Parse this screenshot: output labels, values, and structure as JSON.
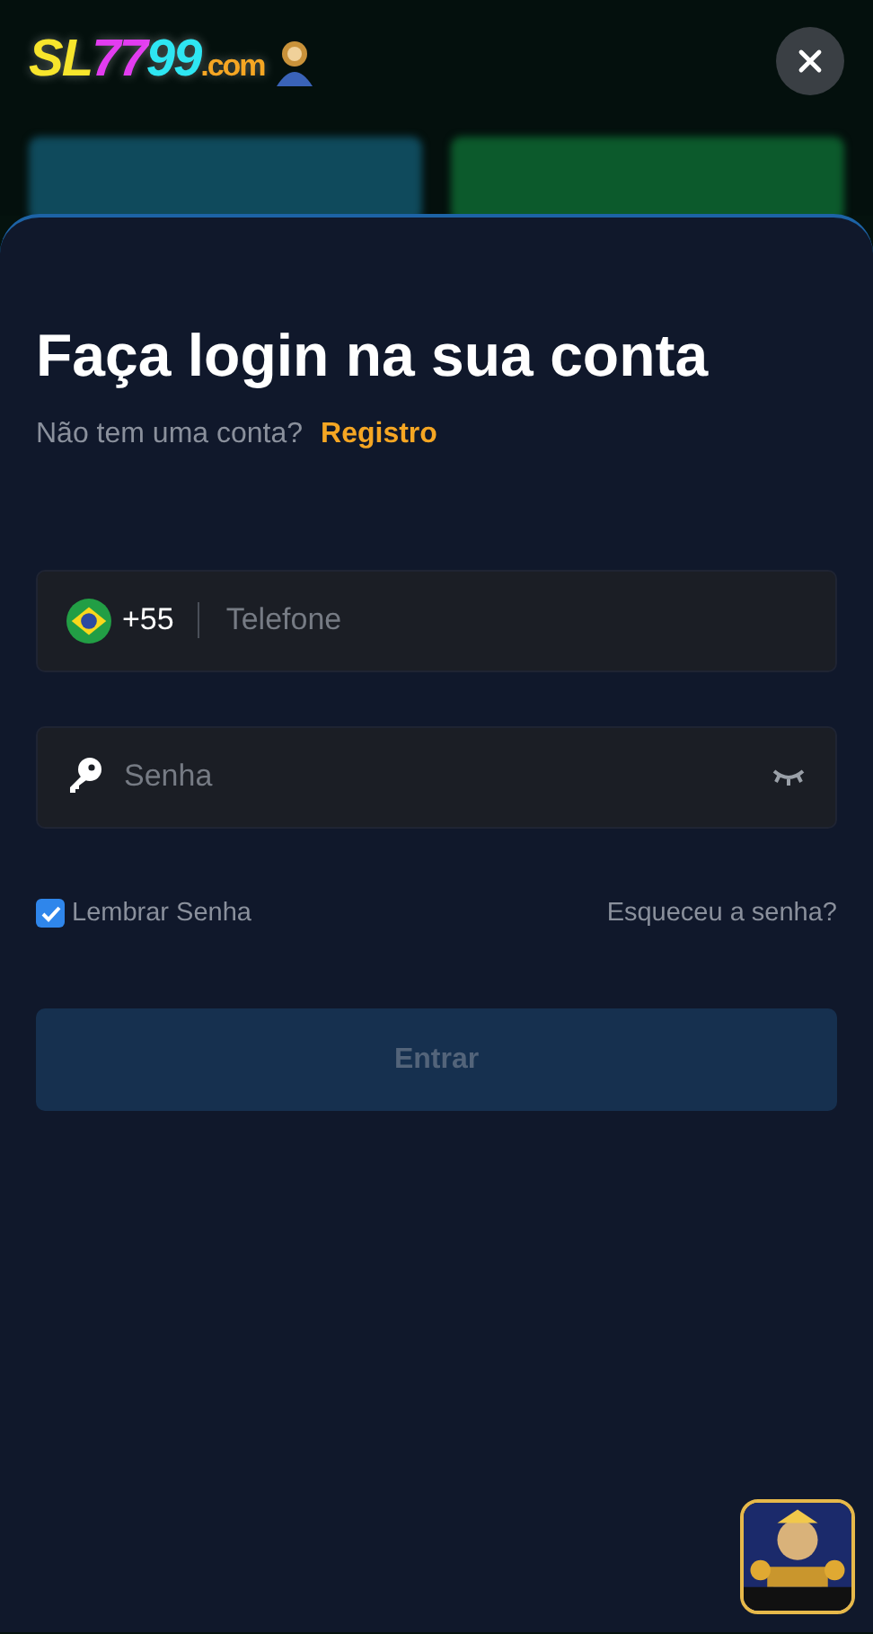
{
  "logo": [
    {
      "text": "SL",
      "color": "#f7e52c"
    },
    {
      "text": "77",
      "color": "#e23cf0"
    },
    {
      "text": "99",
      "color": "#2ee6f2"
    },
    {
      "text": ".com",
      "color": "#f5a623"
    }
  ],
  "title": "Faça login na sua conta",
  "subtitle": {
    "text": "Não tem uma conta?",
    "link": "Registro"
  },
  "phone": {
    "code": "+55",
    "placeholder": "Telefone"
  },
  "password": {
    "placeholder": "Senha"
  },
  "remember": {
    "label": "Lembrar Senha",
    "checked": true
  },
  "forgot": "Esqueceu a senha?",
  "submit": {
    "label": "Entrar",
    "disabled": true
  }
}
